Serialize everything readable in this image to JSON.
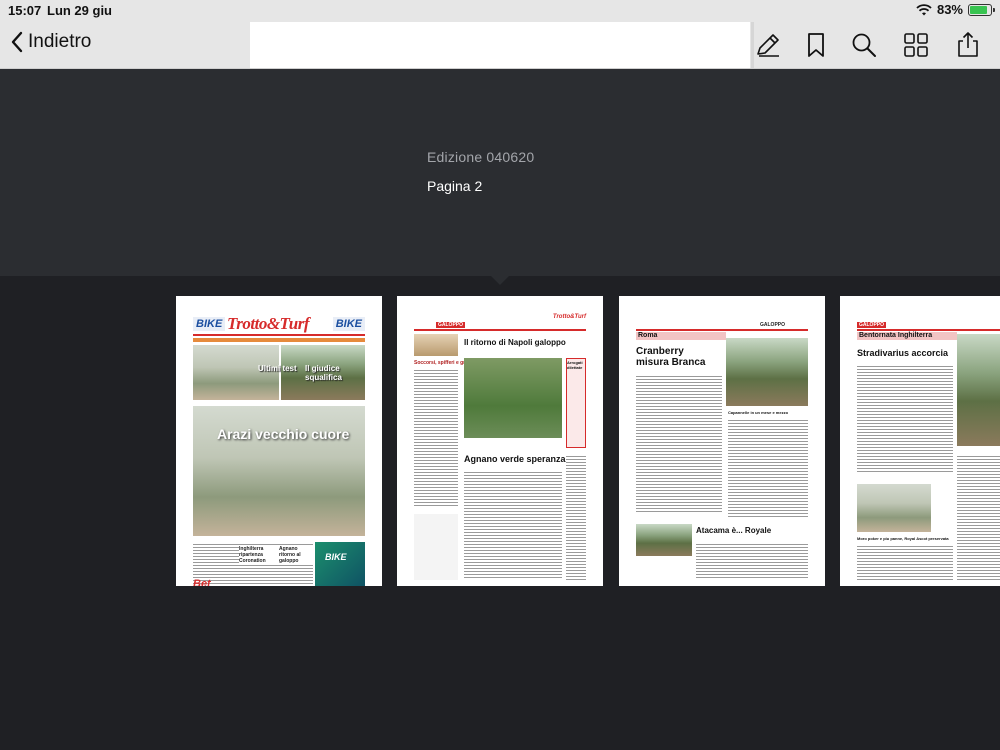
{
  "status_bar": {
    "time": "15:07",
    "date": "Lun 29 giu",
    "battery": "83%",
    "battery_level": 0.83
  },
  "nav": {
    "back_label": "Indietro"
  },
  "header": {
    "edition": "Edizione 040620",
    "page": "Pagina 2"
  },
  "thumbnails": {
    "cover": {
      "bike_left": "BIKE",
      "masthead": "Trotto&Turf",
      "bike_right": "BIKE",
      "teaser_1": "Ultimi test",
      "teaser_2": "Il giudice squalifica",
      "headline": "Arazi vecchio cuore",
      "bet": "Bet",
      "promo": "BIKE",
      "bottom_1": "Inghilterra ripartenza Coronation",
      "bottom_2": "Agnano ritorno al galoppo"
    },
    "page2": {
      "section": "GALOPPO",
      "headline": "Il ritorno di Napoli galoppo",
      "kicker": "Soccorsi, spifferi e grida",
      "main_headline": "Agnano verde speranza",
      "sidebar": "Arrogati dilettate",
      "logo": "Trotto&Turf"
    },
    "page3": {
      "section": "GALOPPO",
      "place": "Roma",
      "headline": "Cranberry misura Branca",
      "headline_2": "Atacama è... Royale",
      "box_title": "Capannelle in un mese e mezzo"
    },
    "page4": {
      "section": "GALOPPO",
      "place": "Bentornata Inghilterra",
      "headline": "Stradivarius accorcia",
      "caption": "Moro poker e piu panne, Royal Ascot preservata"
    }
  },
  "colors": {
    "statusbar_bg": "#e6e6e6",
    "header_bg": "#2b2d31",
    "strip_bg": "#1f2024",
    "accent_red": "#d62b2b"
  },
  "icons": {
    "back": "chevron-left-icon",
    "annotate": "pen-icon",
    "bookmark": "bookmark-icon",
    "search": "magnifier-icon",
    "grid": "thumbnails-grid-icon",
    "share": "share-icon"
  }
}
